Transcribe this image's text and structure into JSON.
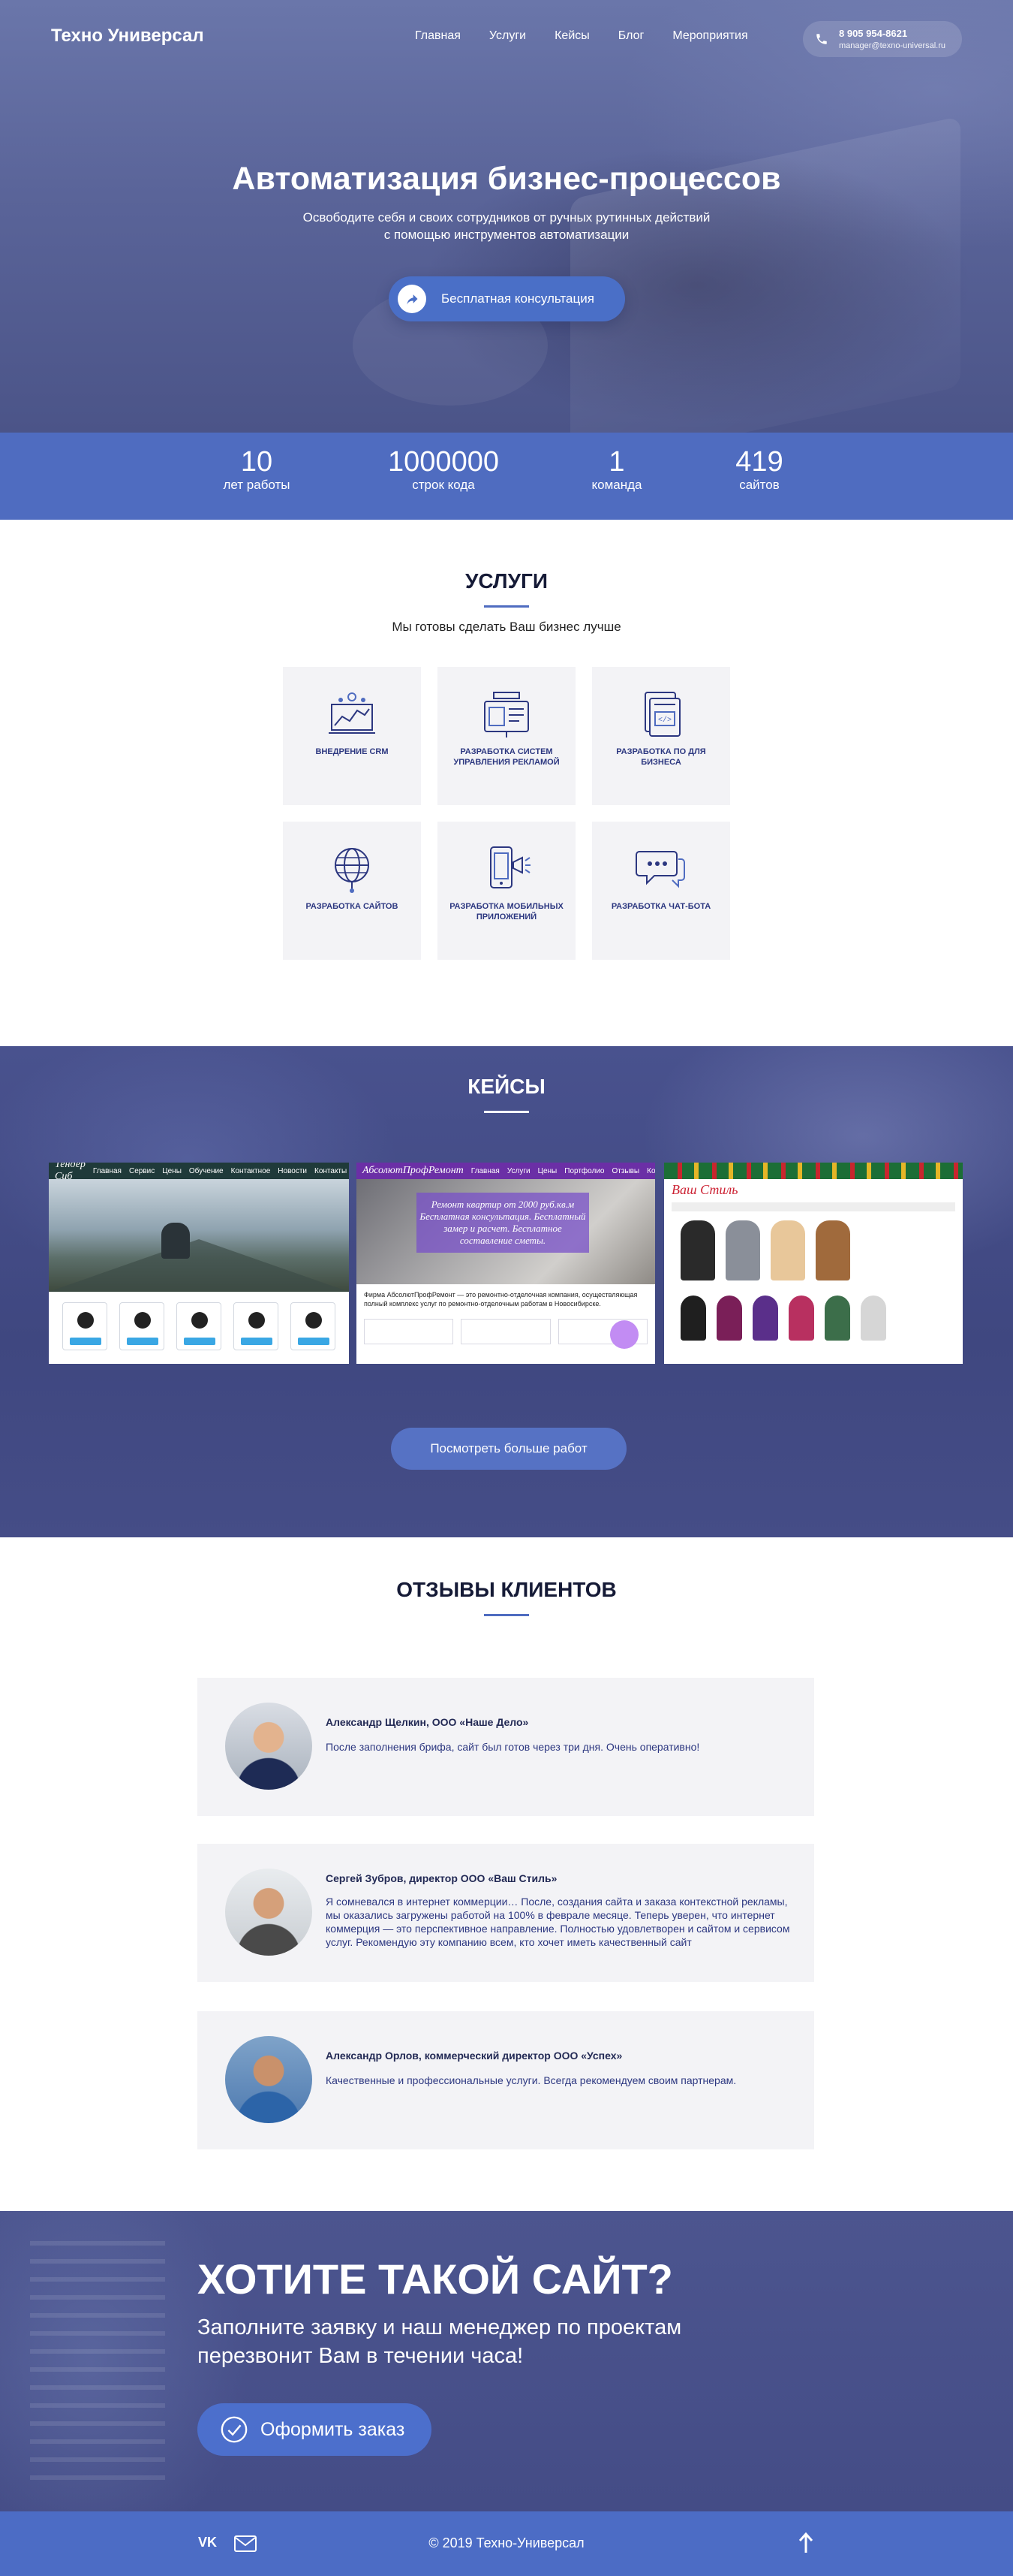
{
  "header": {
    "logo": "Техно Универсал",
    "nav": [
      "Главная",
      "Услуги",
      "Кейсы",
      "Блог",
      "Мероприятия"
    ],
    "phone": "8 905 954-8621",
    "email": "manager@texno-universal.ru"
  },
  "hero": {
    "title": "Автоматизация бизнес-процессов",
    "subtitle": "Освободите себя и своих сотрудников от ручных рутинных действий с помощью инструментов автоматизации",
    "cta": "Бесплатная консультация"
  },
  "stats": [
    {
      "value": "10",
      "label": "лет работы"
    },
    {
      "value": "1000000",
      "label": "строк кода"
    },
    {
      "value": "1",
      "label": "команда"
    },
    {
      "value": "419",
      "label": "сайтов"
    }
  ],
  "services": {
    "title": "УСЛУГИ",
    "tagline": "Мы готовы сделать Ваш бизнес лучше",
    "items": [
      {
        "label": "ВНЕДРЕНИЕ CRM",
        "icon": "crm-dashboard-icon"
      },
      {
        "label": "РАЗРАБОТКА СИСТЕМ УПРАВЛЕНИЯ РЕКЛАМОЙ",
        "icon": "ad-system-icon"
      },
      {
        "label": "РАЗРАБОТКА ПО ДЛЯ БИЗНЕСА",
        "icon": "code-document-icon"
      },
      {
        "label": "РАЗРАБОТКА САЙТОВ",
        "icon": "globe-icon"
      },
      {
        "label": "РАЗРАБОТКА МОБИЛЬНЫХ ПРИЛОЖЕНИЙ",
        "icon": "mobile-app-icon"
      },
      {
        "label": "РАЗРАБОТКА ЧАТ-БОТА",
        "icon": "chat-bubble-icon"
      }
    ]
  },
  "cases": {
    "title": "КЕЙСЫ",
    "more_button": "Посмотреть больше работ",
    "case1": {
      "brand": "Тендер Сиб",
      "nav": [
        "Главная",
        "Сервис",
        "Цены",
        "Обучение",
        "Контактное",
        "Новости",
        "Контакты"
      ]
    },
    "case2": {
      "brand": "АбсолютПрофРемонт",
      "nav": [
        "Главная",
        "Услуги",
        "Цены",
        "Портфолио",
        "Отзывы",
        "Контакты"
      ],
      "banner": "Ремонт квартир от 2000 руб.кв.м Бесплатная консультация. Бесплатный замер и расчет. Бесплатное составление сметы.",
      "text": "Фирма АбсолютПрофРемонт — это ремонтно-отделочная компания, осуществляющая полный комплекс услуг по ремонтно-отделочным работам в Новосибирске."
    },
    "case3": {
      "brand": "Ваш Стиль"
    }
  },
  "reviews": {
    "title": "ОТЗЫВЫ КЛИЕНТОВ",
    "items": [
      {
        "name": "Александр Щелкин, ООО «Наше Дело»",
        "text": "После заполнения брифа, сайт был готов через три дня. Очень оперативно!"
      },
      {
        "name": "Сергей Зубров, директор ООО «Ваш Стиль»",
        "text": "Я сомневался в интернет коммерции… После, создания сайта и заказа контекстной рекламы, мы оказались загружены работой на 100% в феврале месяце. Теперь уверен, что интернет коммерция — это перспективное направление. Полностью удовлетворен и сайтом и сервисом услуг. Рекомендую эту компанию всем, кто хочет иметь качественный сайт"
      },
      {
        "name": "Александр Орлов, коммерческий директор ООО «Успех»",
        "text": "Качественные и профессиональные услуги. Всегда рекомендуем своим партнерам."
      }
    ]
  },
  "order": {
    "title": "ХОТИТЕ ТАКОЙ САЙТ?",
    "subtitle": "Заполните заявку и наш менеджер по проектам перезвонит Вам в течении часа!",
    "button": "Оформить заказ"
  },
  "footer": {
    "copyright": "© 2019 Техно-Универсал",
    "vk": "VK"
  },
  "colors": {
    "accent": "#4f6cc0",
    "dark": "#151a36"
  }
}
